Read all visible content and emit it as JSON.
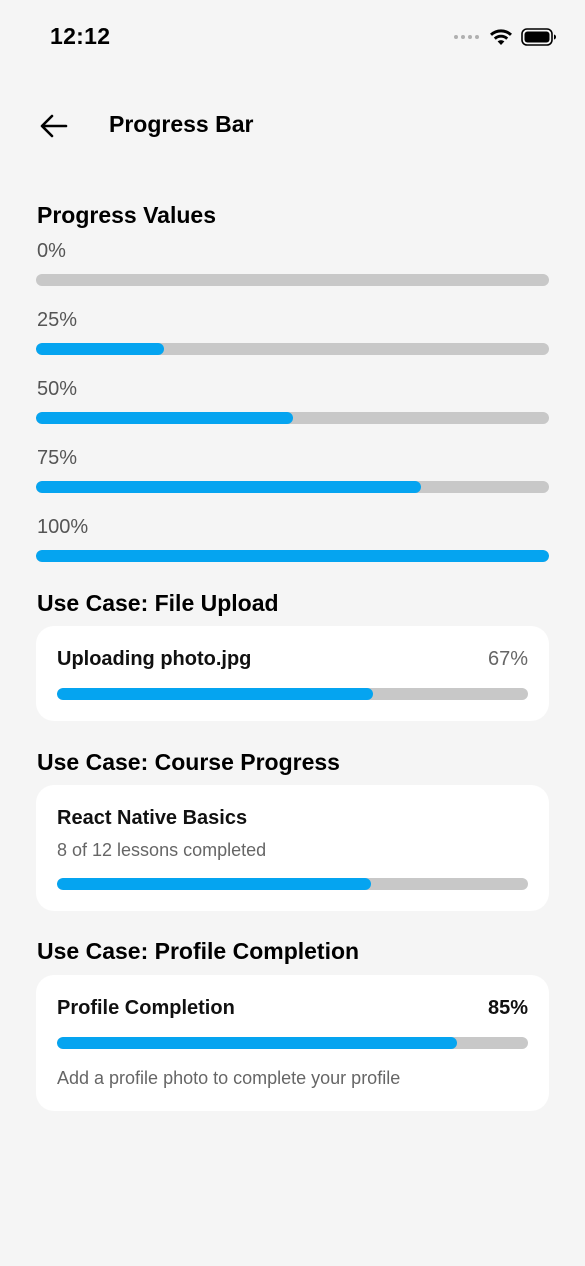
{
  "status_bar": {
    "time": "12:12",
    "icons": [
      "signal-dots-icon",
      "wifi-icon",
      "battery-icon"
    ]
  },
  "header": {
    "back_icon": "arrow-left-icon",
    "title": "Progress Bar"
  },
  "progress_values": {
    "title": "Progress Values",
    "items": [
      {
        "label": "0%",
        "progress": 0
      },
      {
        "label": "25%",
        "progress": 0.25
      },
      {
        "label": "50%",
        "progress": 0.5
      },
      {
        "label": "75%",
        "progress": 0.75
      },
      {
        "label": "100%",
        "progress": 1
      }
    ]
  },
  "file_upload": {
    "section_title": "Use Case: File Upload",
    "label": "Uploading photo.jpg",
    "percent_label": "67%",
    "progress": 0.67
  },
  "course_progress": {
    "section_title": "Use Case: Course Progress",
    "course_name": "React Native Basics",
    "lessons_text": "8 of 12 lessons completed",
    "progress": 0.6667
  },
  "profile_completion": {
    "section_title": "Use Case: Profile Completion",
    "label": "Profile Completion",
    "percent_label": "85%",
    "progress": 0.85,
    "hint": "Add a profile photo to complete your profile"
  },
  "colors": {
    "accent": "#05a4f0",
    "track": "#c8c8c8",
    "background": "#f5f5f5",
    "card": "#ffffff"
  }
}
